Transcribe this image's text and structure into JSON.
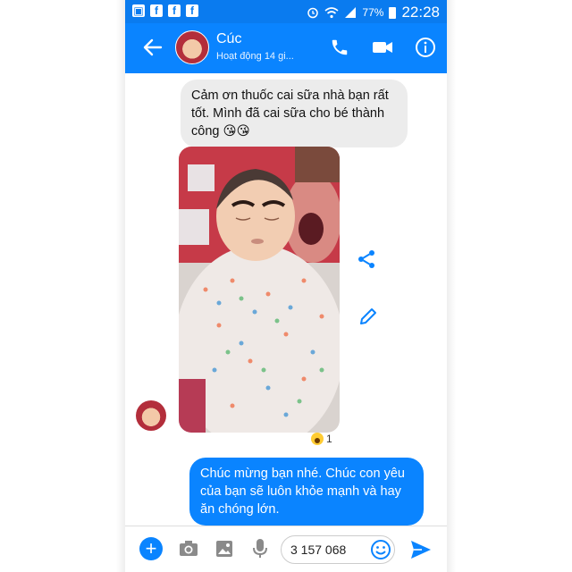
{
  "status_bar": {
    "icons": [
      "gallery-icon",
      "facebook-icon",
      "facebook-icon",
      "facebook-icon"
    ],
    "battery": "77%",
    "time": "22:28"
  },
  "header": {
    "name": "Cúc",
    "status": "Hoạt động 14 gi..."
  },
  "messages": {
    "incoming_text": "Cảm ơn thuốc cai sữa nhà bạn rất tốt. Mình đã cai sữa cho bé thành công 😘😘",
    "reaction_count": "1",
    "outgoing_text": "Chúc mừng bạn nhé. Chúc con yêu của bạn sẽ luôn khỏe mạnh và hay ăn chóng lớn."
  },
  "composer": {
    "input_value": "3 157 068"
  },
  "colors": {
    "accent": "#0a84ff",
    "status_bar": "#0a7bef",
    "incoming_bubble": "#ececec"
  }
}
